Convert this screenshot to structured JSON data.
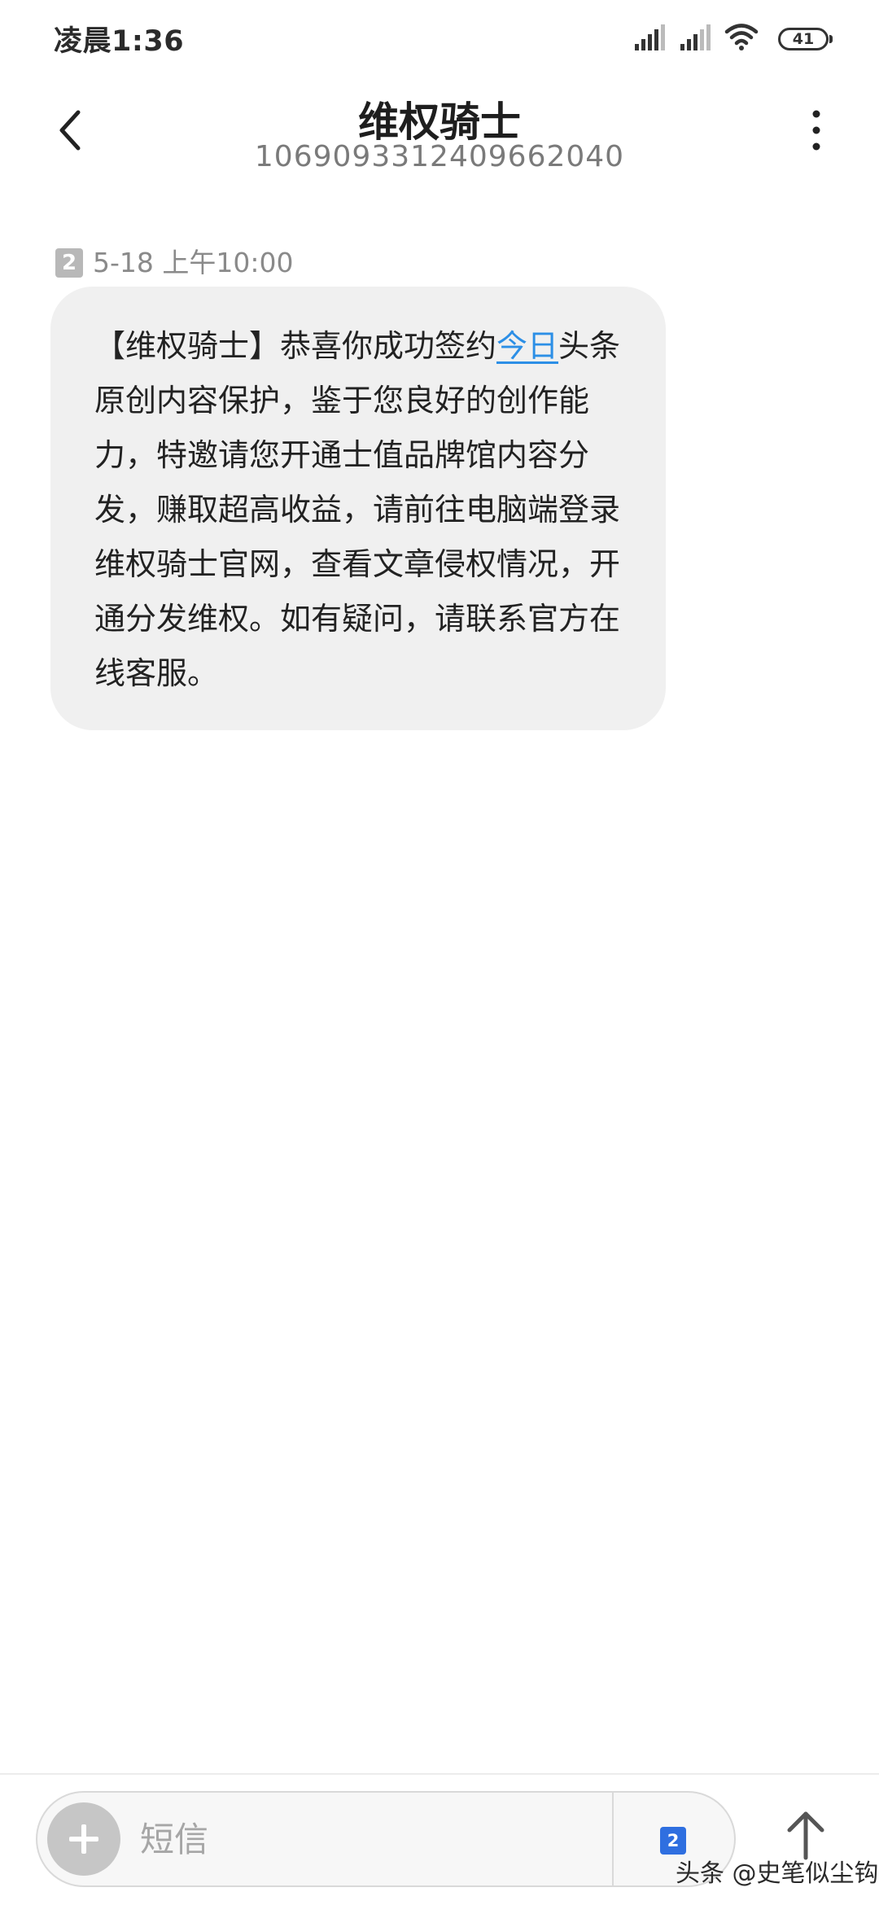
{
  "status_bar": {
    "time": "凌晨1:36",
    "battery": "41",
    "icons": [
      "signal-icon",
      "signal-icon",
      "wifi-icon",
      "battery-icon"
    ]
  },
  "header": {
    "title": "维权骑士",
    "number": "1069093312409662040",
    "back_icon": "chevron-left-icon",
    "menu_icon": "more-vertical-icon"
  },
  "message": {
    "sim": "2",
    "time": "5-18 上午10:00",
    "text_before_link": "【维权骑士】恭喜你成功签约",
    "link_text": "今日",
    "text_after_link": "头条原创内容保护，鉴于您良好的创作能力，特邀请您开通士值品牌馆内容分发，赚取超高收益，请前往电脑端登录维权骑士官网，查看文章侵权情况，开通分发维权。如有疑问，请联系官方在线客服。",
    "link_color": "#2c8fe6",
    "bubble_color": "#f0f0f0"
  },
  "input_bar": {
    "placeholder": "短信",
    "sim_select": "2",
    "attach_icon": "plus-icon",
    "send_icon": "arrow-up-icon",
    "sim_color": "#2f6fe0"
  },
  "watermark": "头条 @史笔似尘钩"
}
